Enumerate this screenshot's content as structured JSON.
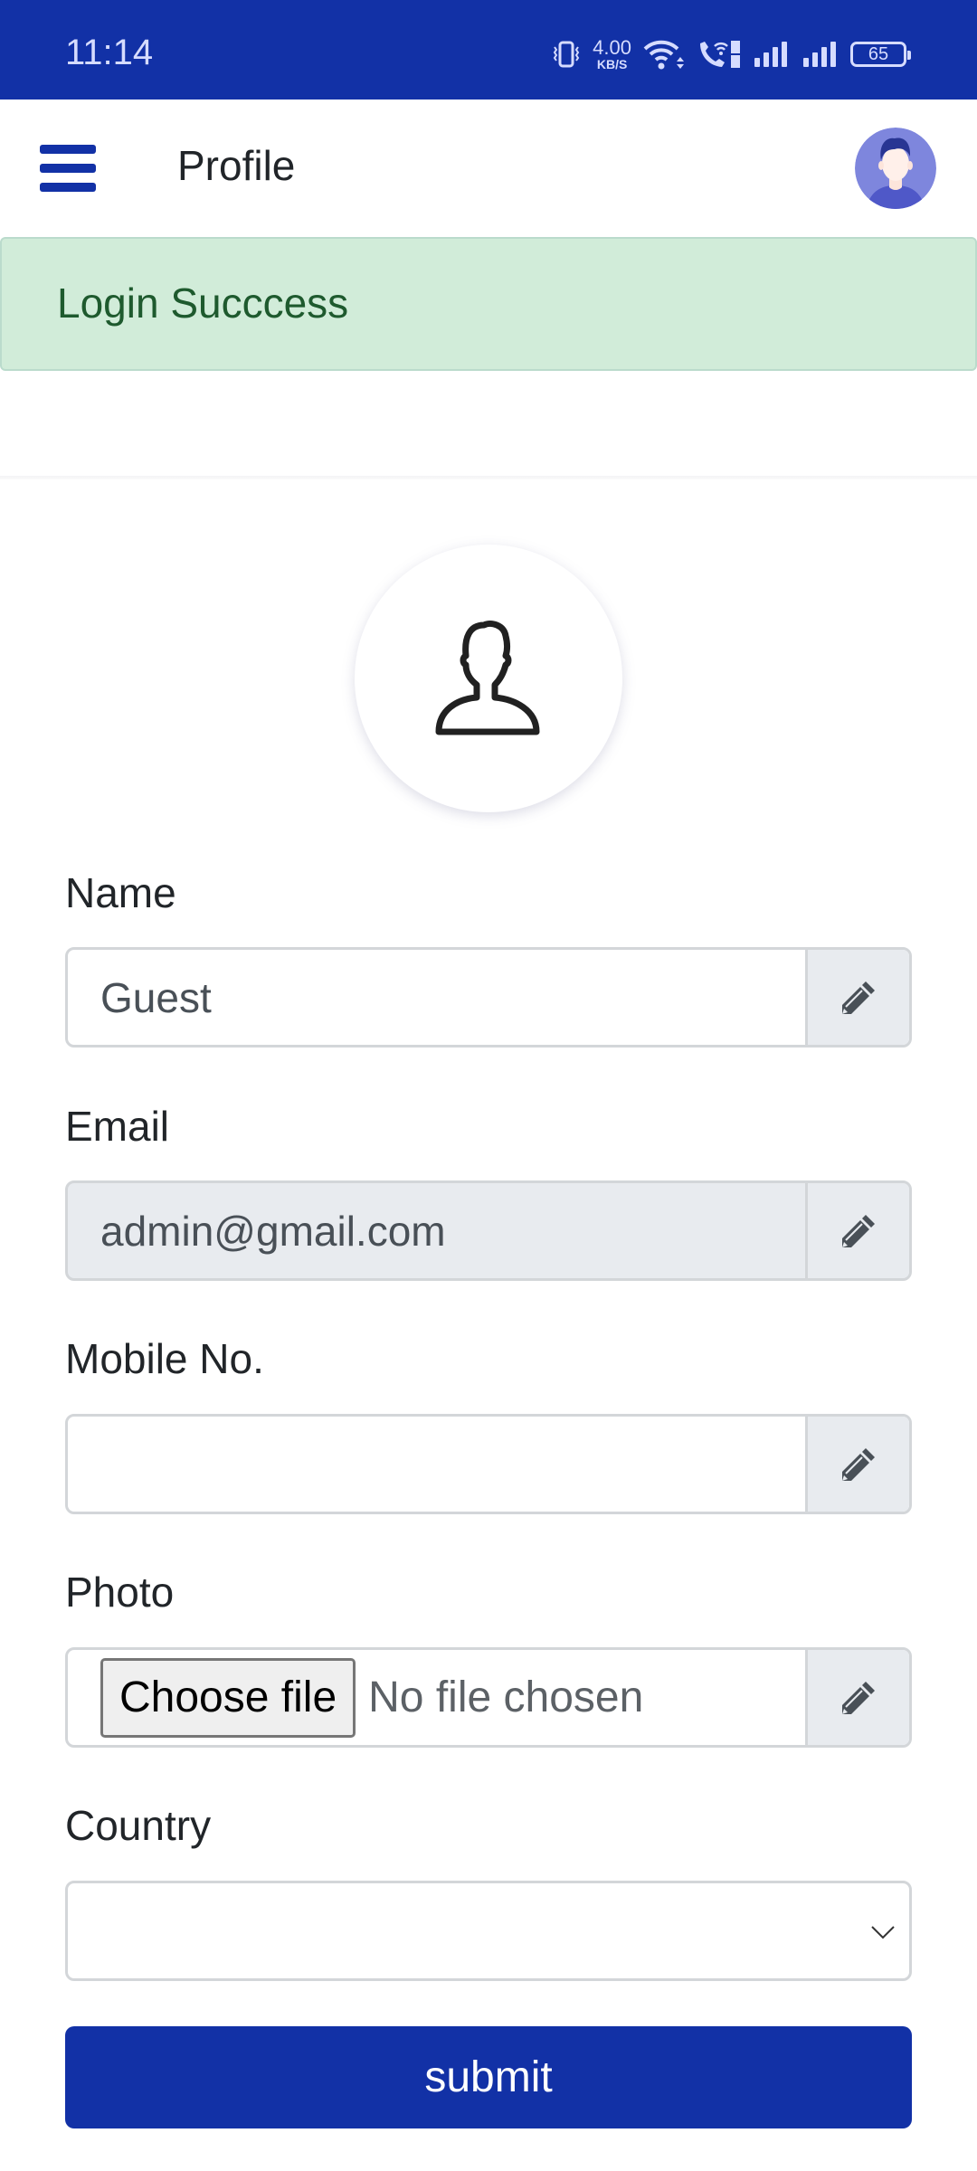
{
  "status_bar": {
    "time": "11:14",
    "net_speed_value": "4.00",
    "net_speed_unit": "KB/S",
    "battery": "65",
    "icons": [
      "vibrate-icon",
      "wifi-icon",
      "wifi-calling-icon",
      "dual-sim-icon",
      "signal-icon",
      "signal-icon",
      "battery-icon"
    ]
  },
  "header": {
    "title": "Profile",
    "menu_icon": "hamburger-icon",
    "avatar_icon": "user-avatar"
  },
  "alert": {
    "message": "Login Succcess",
    "type": "success"
  },
  "profile_photo": {
    "icon": "user-outline-icon"
  },
  "form": {
    "name": {
      "label": "Name",
      "value": "Guest",
      "edit_icon": "pencil-icon"
    },
    "email": {
      "label": "Email",
      "value": "admin@gmail.com",
      "disabled": true,
      "edit_icon": "pencil-icon"
    },
    "mobile": {
      "label": "Mobile No.",
      "value": "",
      "edit_icon": "pencil-icon"
    },
    "photo": {
      "label": "Photo",
      "button_label": "Choose file",
      "status": "No file chosen",
      "edit_icon": "pencil-icon"
    },
    "country": {
      "label": "Country",
      "selected": ""
    },
    "submit_label": "submit"
  },
  "colors": {
    "primary": "#1231a6",
    "alert_bg": "#d1ecd9",
    "alert_text": "#1e5a2e",
    "addon_bg": "#e8ebef"
  }
}
